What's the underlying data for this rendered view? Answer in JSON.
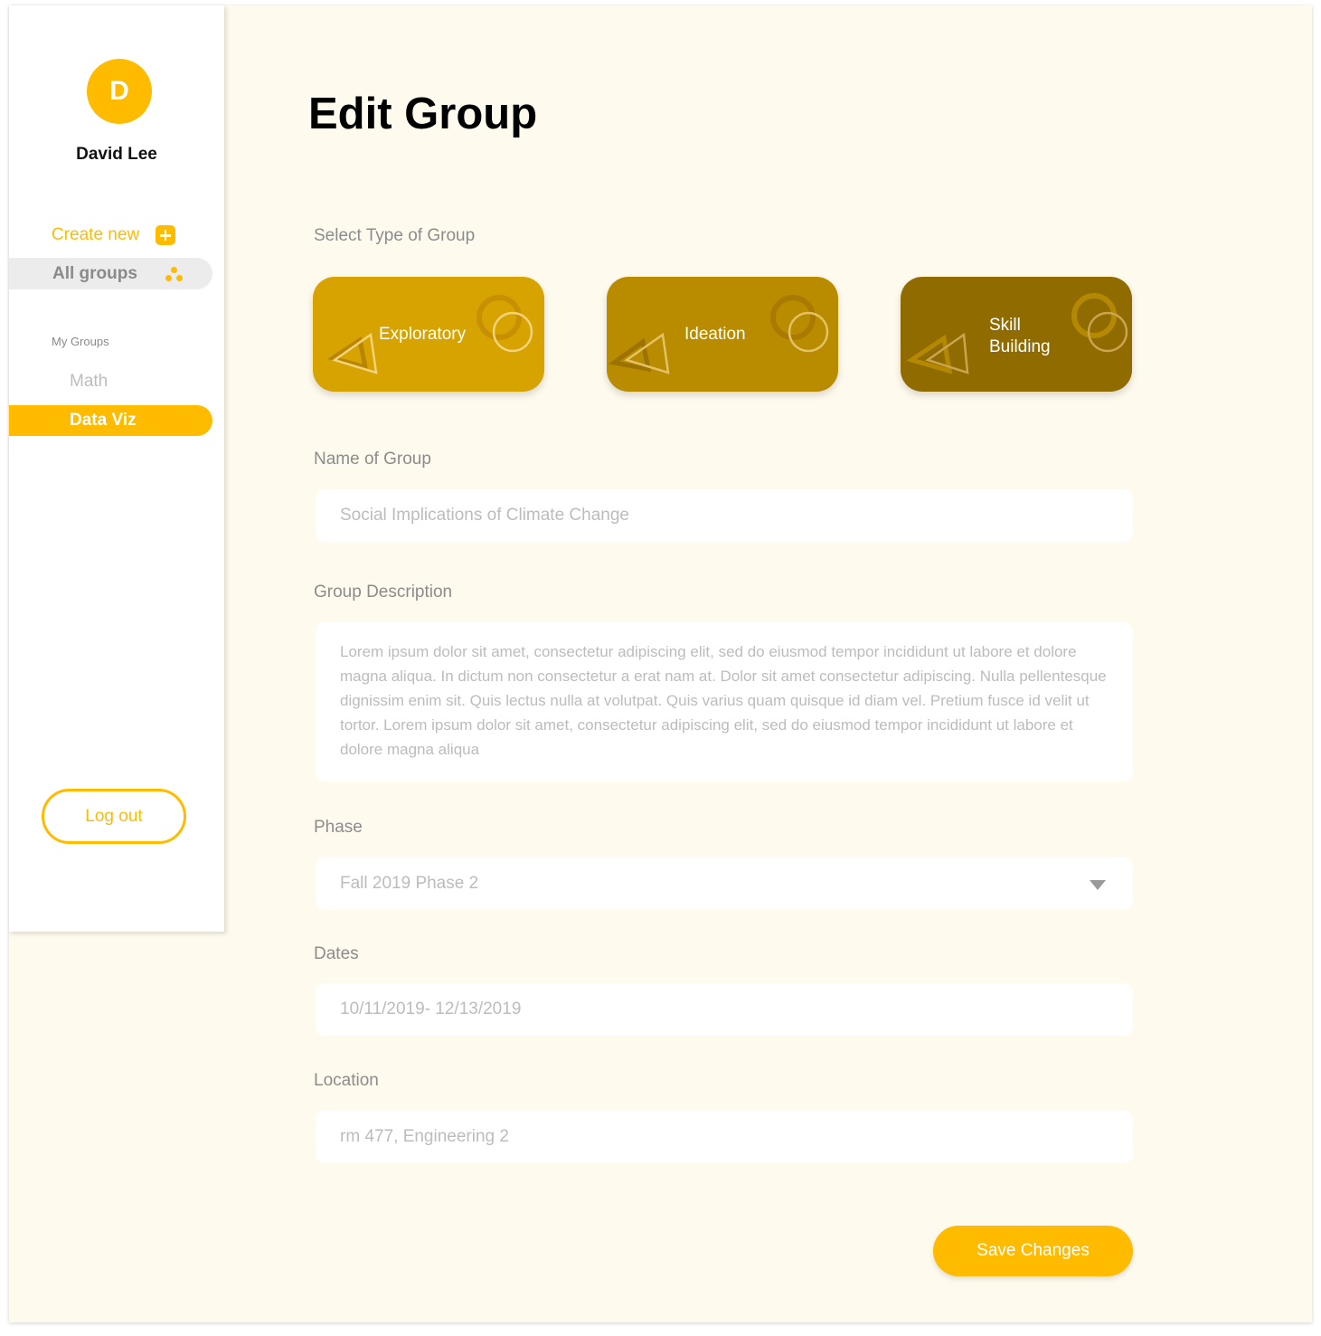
{
  "user": {
    "initial": "D",
    "name": "David Lee"
  },
  "nav": {
    "create_new": "Create new",
    "all_groups": "All groups"
  },
  "my_groups": {
    "label": "My Groups",
    "items": [
      "Math",
      "Data Viz"
    ]
  },
  "logout_label": "Log out",
  "page_title": "Edit Group",
  "group_type": {
    "label": "Select Type of Group",
    "options": [
      {
        "label": "Exploratory",
        "color": "#d6a300"
      },
      {
        "label": "Ideation",
        "color": "#b98c00"
      },
      {
        "label_lines": [
          "Skill",
          "Building"
        ],
        "color": "#8f6b00"
      }
    ]
  },
  "name_field": {
    "label": "Name of Group",
    "value": "Social Implications of Climate Change"
  },
  "description_field": {
    "label": "Group Description",
    "value": "Lorem ipsum dolor sit amet, consectetur adipiscing elit, sed do eiusmod tempor incididunt ut labore et dolore magna aliqua. In dictum non consectetur a erat nam at. Dolor sit amet consectetur adipiscing. Nulla pellentesque dignissim enim sit. Quis lectus nulla at volutpat. Quis varius quam quisque id diam vel. Pretium fusce id velit ut tortor. Lorem ipsum dolor sit amet, consectetur adipiscing elit, sed do eiusmod tempor incididunt ut labore et dolore magna aliqua"
  },
  "phase_field": {
    "label": "Phase",
    "value": "Fall 2019 Phase 2"
  },
  "dates_field": {
    "label": "Dates",
    "value": "10/11/2019- 12/13/2019"
  },
  "location_field": {
    "label": "Location",
    "value": "rm 477, Engineering 2"
  },
  "save_label": "Save Changes",
  "colors": {
    "accent": "#ffbb00",
    "background": "#fffaee"
  }
}
